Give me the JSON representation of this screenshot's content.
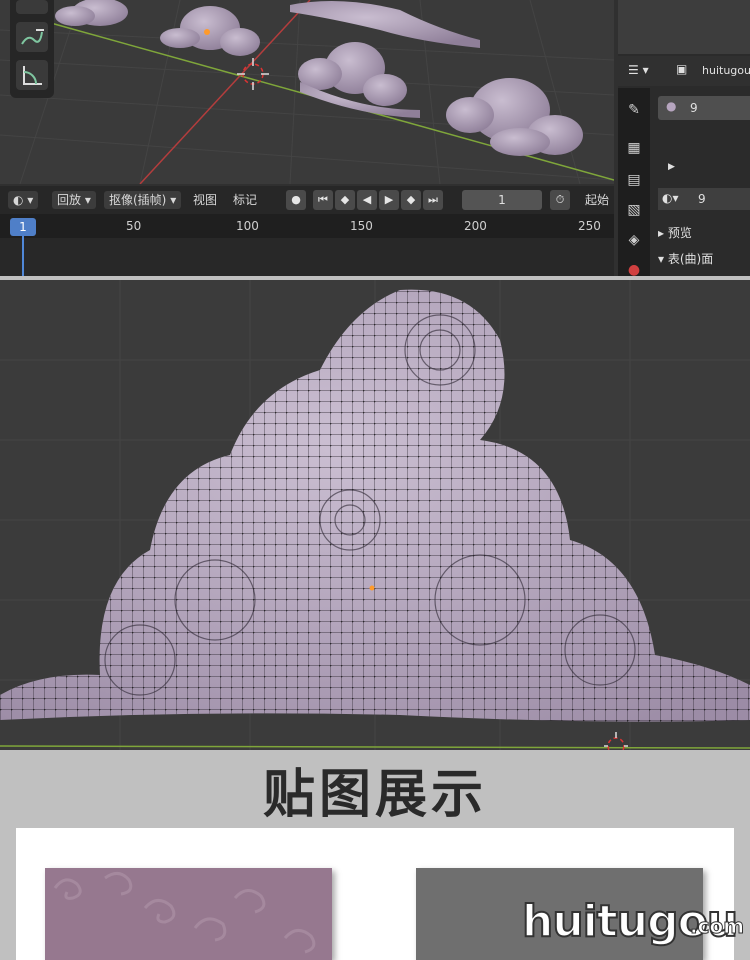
{
  "timeline": {
    "playback_menu": "回放",
    "keying_menu": "抠像(插帧)",
    "view_menu": "视图",
    "marker_menu": "标记",
    "current_frame": "1",
    "frame_marker": "1",
    "start_label": "起始",
    "ruler_ticks": [
      "50",
      "100",
      "150",
      "200",
      "250"
    ]
  },
  "properties": {
    "object_name": "huitugou",
    "material_slot": "9",
    "material_name": "9",
    "section_preview": "预览",
    "section_surface": "表(曲)面"
  },
  "showcase": {
    "heading": "贴图展示",
    "watermark": "huitugou",
    "watermark_suffix": ".com"
  },
  "colors": {
    "accent": "#4f7fc8",
    "cloud": "#b6a5bf",
    "texture_purple": "#96788f",
    "texture_gray": "#6f6f6f"
  },
  "icons": [
    "pencil-annotate-icon",
    "measure-icon",
    "timeline-editor-icon",
    "record-icon",
    "jump-start-icon",
    "prev-keyframe-icon",
    "play-reverse-icon",
    "play-icon",
    "next-keyframe-icon",
    "jump-end-icon",
    "stopwatch-icon",
    "tool-icon",
    "render-icon",
    "output-icon",
    "view-layer-icon",
    "scene-icon",
    "world-icon",
    "material-sphere-icon",
    "shading-icon"
  ]
}
